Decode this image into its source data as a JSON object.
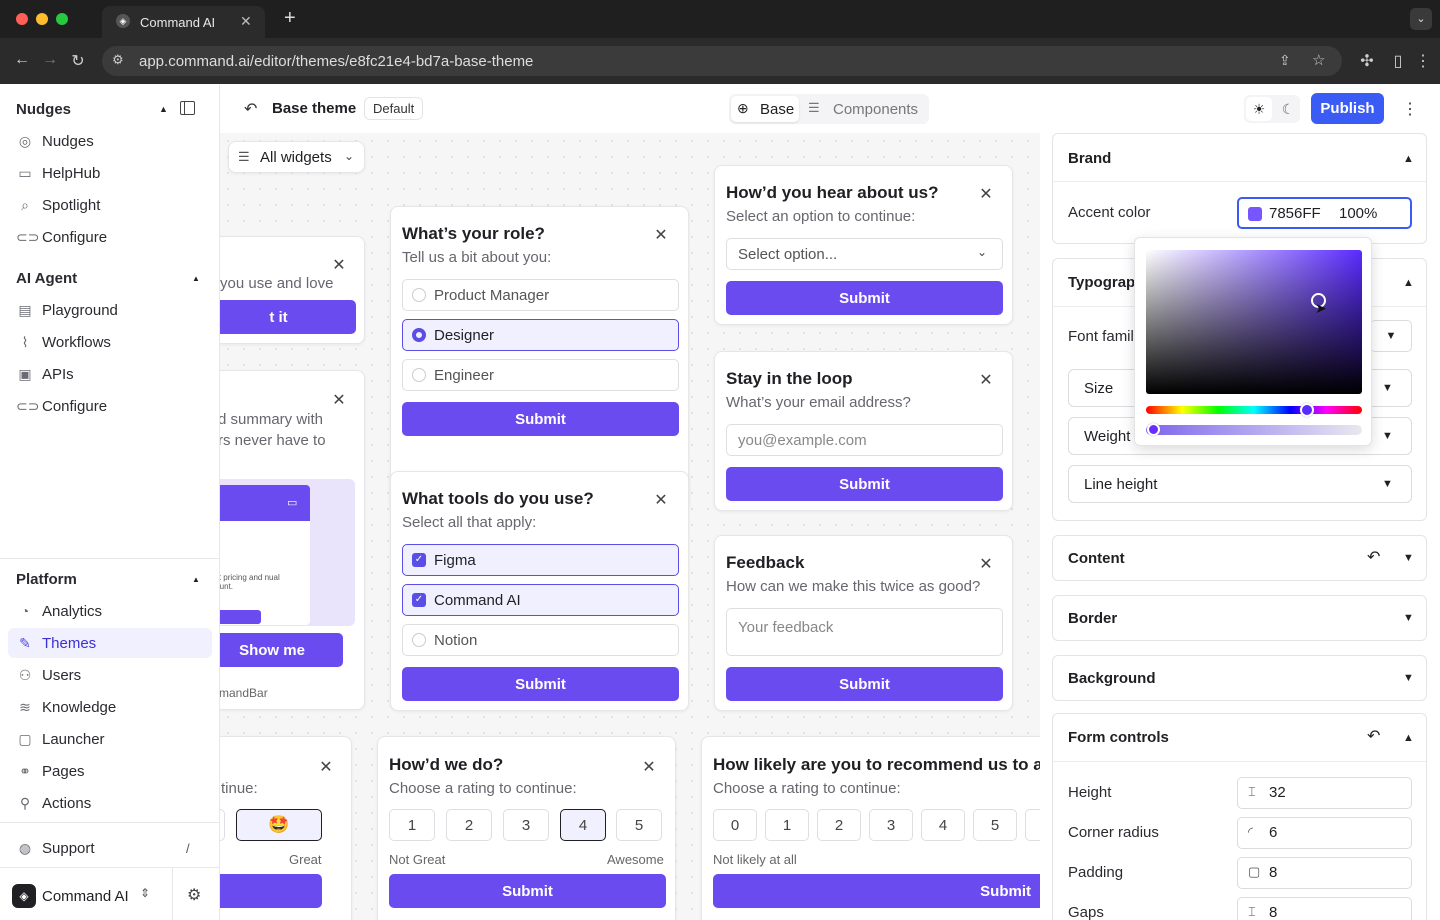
{
  "browser": {
    "tab_title": "Command AI",
    "url": "app.command.ai/editor/themes/e8fc21e4-bd7a-base-theme"
  },
  "sidebar": {
    "sections": [
      {
        "title": "Nudges",
        "items": [
          {
            "label": "Nudges",
            "icon": "target-icon"
          },
          {
            "label": "HelpHub",
            "icon": "book-icon"
          },
          {
            "label": "Spotlight",
            "icon": "search-icon"
          },
          {
            "label": "Configure",
            "icon": "toggle-icon"
          }
        ]
      },
      {
        "title": "AI Agent",
        "items": [
          {
            "label": "Playground",
            "icon": "chat-icon"
          },
          {
            "label": "Workflows",
            "icon": "workflow-icon"
          },
          {
            "label": "APIs",
            "icon": "api-icon"
          },
          {
            "label": "Configure",
            "icon": "toggle-icon"
          }
        ]
      },
      {
        "title": "Platform",
        "items": [
          {
            "label": "Analytics",
            "icon": "analytics-icon"
          },
          {
            "label": "Themes",
            "icon": "brush-icon"
          },
          {
            "label": "Users",
            "icon": "users-icon"
          },
          {
            "label": "Knowledge",
            "icon": "layers-icon"
          },
          {
            "label": "Launcher",
            "icon": "window-icon"
          },
          {
            "label": "Pages",
            "icon": "link-icon"
          },
          {
            "label": "Actions",
            "icon": "actions-icon"
          }
        ]
      }
    ],
    "support": {
      "label": "Support",
      "shortcut": "/"
    },
    "workspace": "Command AI"
  },
  "toolbar": {
    "title": "Base theme",
    "badge": "Default",
    "tab_base": "Base",
    "tab_components": "Components",
    "publish": "Publish"
  },
  "canvas": {
    "filter": "All widgets",
    "partial1": {
      "subtitle": "you use and love",
      "button": "t it"
    },
    "partial2": {
      "line1": "d summary with",
      "line2": "rs never have to",
      "preview_text": "about pricing and nual discount.",
      "button": "Show me",
      "brand": "mandBar"
    },
    "role": {
      "title": "What’s your role?",
      "subtitle": "Tell us a bit about you:",
      "options": [
        "Product Manager",
        "Designer",
        "Engineer"
      ],
      "selected": "Designer",
      "button": "Submit"
    },
    "tools": {
      "title": "What tools do you use?",
      "subtitle": "Select all that apply:",
      "options": [
        "Figma",
        "Command AI",
        "Notion"
      ],
      "button": "Submit"
    },
    "hear": {
      "title": "How’d you hear about us?",
      "subtitle": "Select an option to continue:",
      "placeholder": "Select option...",
      "button": "Submit"
    },
    "loop": {
      "title": "Stay in the loop",
      "subtitle": "What’s your email address?",
      "placeholder": "you@example.com",
      "button": "Submit"
    },
    "feedback": {
      "title": "Feedback",
      "subtitle": "How can we make this twice as good?",
      "placeholder": "Your feedback",
      "button": "Submit"
    },
    "partial3": {
      "subtitle": "tinue:",
      "emoji": "🤩",
      "label_right": "Great",
      "button": "t"
    },
    "rating": {
      "title": "How’d we do?",
      "subtitle": "Choose a rating to continue:",
      "options": [
        "1",
        "2",
        "3",
        "4",
        "5"
      ],
      "selected": "4",
      "label_left": "Not Great",
      "label_right": "Awesome",
      "button": "Submit"
    },
    "nps": {
      "title": "How likely are you to recommend us to a fr",
      "subtitle": "Choose a rating to continue:",
      "options": [
        "0",
        "1",
        "2",
        "3",
        "4",
        "5"
      ],
      "label_left": "Not likely at all",
      "button": "Submit"
    }
  },
  "panel": {
    "brand": {
      "title": "Brand",
      "accent_label": "Accent color",
      "accent_hex": "7856FF",
      "accent_opacity": "100%",
      "accent_color": "#7856FF"
    },
    "typography": {
      "title": "Typograp",
      "font_family": "Font famil",
      "size": "Size",
      "weight": "Weight",
      "line_height": "Line height"
    },
    "content": "Content",
    "border": "Border",
    "background": "Background",
    "form_controls": {
      "title": "Form controls",
      "height_label": "Height",
      "height": "32",
      "radius_label": "Corner radius",
      "radius": "6",
      "padding_label": "Padding",
      "padding": "8",
      "gaps_label": "Gaps",
      "gaps": "8"
    }
  }
}
